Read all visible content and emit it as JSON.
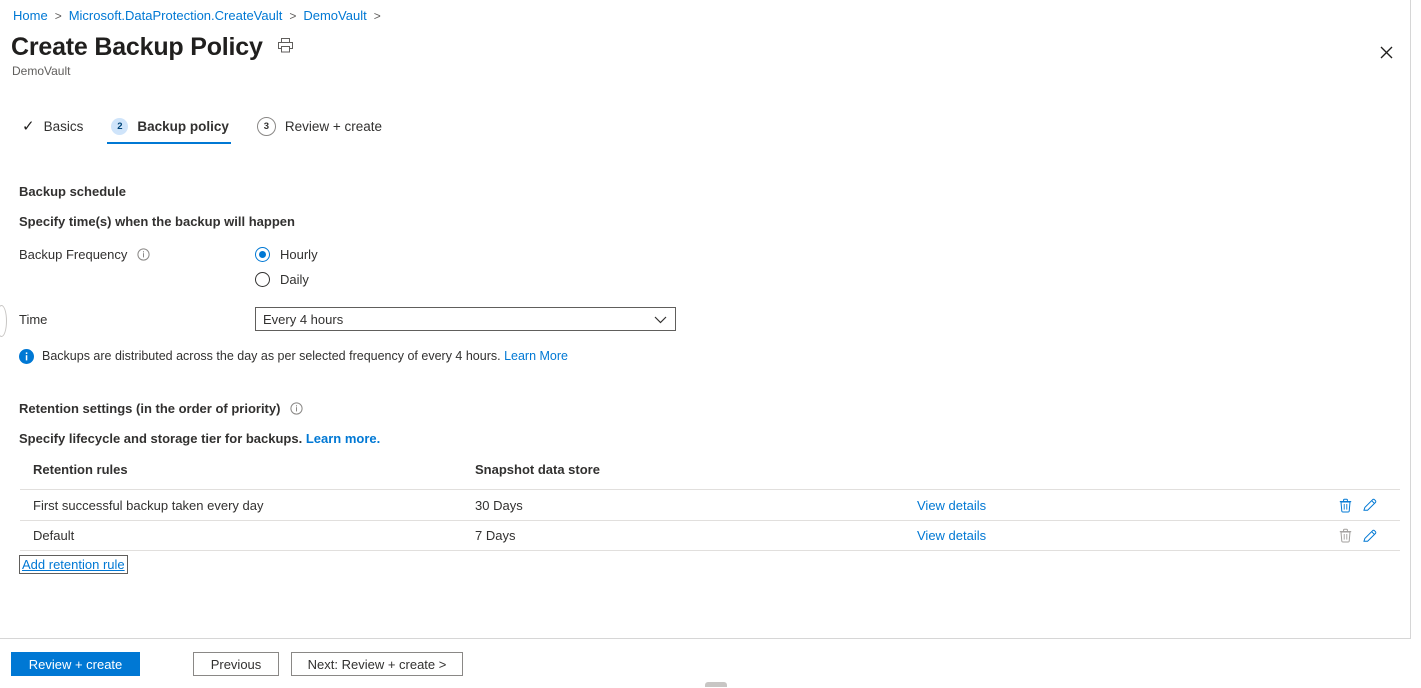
{
  "breadcrumb": {
    "items": [
      {
        "label": "Home"
      },
      {
        "label": "Microsoft.DataProtection.CreateVault"
      },
      {
        "label": "DemoVault"
      }
    ],
    "separator": ">"
  },
  "header": {
    "title": "Create Backup Policy",
    "subtitle": "DemoVault",
    "print_icon": "printer-icon",
    "close_icon": "close-icon"
  },
  "tabs": [
    {
      "label": "Basics",
      "marker": "✓",
      "state": "completed"
    },
    {
      "label": "Backup policy",
      "marker": "2",
      "state": "active"
    },
    {
      "label": "Review + create",
      "marker": "3",
      "state": "upcoming"
    }
  ],
  "schedule": {
    "section_title": "Backup schedule",
    "instruction": "Specify time(s) when the backup will happen",
    "frequency_label": "Backup Frequency",
    "frequency_options": [
      {
        "label": "Hourly",
        "selected": true
      },
      {
        "label": "Daily",
        "selected": false
      }
    ],
    "time_label": "Time",
    "time_value": "Every 4 hours",
    "info_text": "Backups are distributed across the day as per selected frequency of every 4 hours.",
    "info_link": "Learn More"
  },
  "retention": {
    "section_title": "Retention settings (in the order of priority)",
    "instruction": "Specify lifecycle and storage tier for backups.",
    "instruction_link": "Learn more.",
    "columns": [
      "Retention rules",
      "Snapshot data store"
    ],
    "rows": [
      {
        "rule": "First successful backup taken every day",
        "data_store": "30 Days",
        "details_link": "View details",
        "delete_enabled": true,
        "edit_enabled": true
      },
      {
        "rule": "Default",
        "data_store": "7 Days",
        "details_link": "View details",
        "delete_enabled": false,
        "edit_enabled": true
      }
    ],
    "add_rule_label": "Add retention rule"
  },
  "footer": {
    "primary": "Review + create",
    "previous": "Previous",
    "next": "Next: Review + create >"
  },
  "colors": {
    "accent": "#0078d4",
    "link": "#0078d4",
    "badge_fill": "#cfe4fa",
    "disabled_icon": "#a19f9d",
    "border": "#e1dfdd"
  }
}
